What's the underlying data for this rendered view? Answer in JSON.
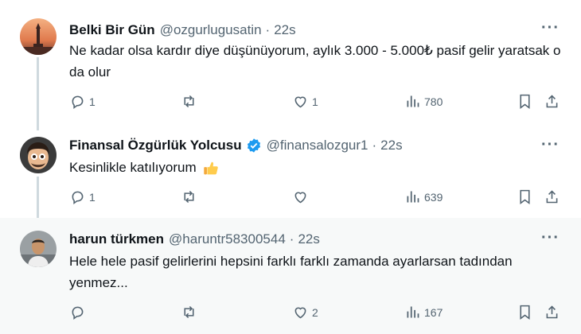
{
  "tweets": [
    {
      "name": "Belki Bir Gün",
      "handle": "@ozgurlugusatin",
      "time": "22s",
      "text": "Ne kadar olsa kardır diye düşünüyorum, aylık 3.000 - 5.000₺ pasif gelir yaratsak o da olur",
      "replies": "1",
      "retweets": "",
      "likes": "1",
      "views": "780"
    },
    {
      "name": "Finansal Özgürlük Yolcusu",
      "handle": "@finansalozgur1",
      "time": "22s",
      "verified": true,
      "text": "Kesinlikle katılıyorum",
      "replies": "1",
      "retweets": "",
      "likes": "",
      "views": "639"
    },
    {
      "name": "harun türkmen",
      "handle": "@haruntr58300544",
      "time": "22s",
      "text": "Hele hele pasif gelirlerini hepsini farklı farklı  zamanda ayarlarsan tadından yenmez...",
      "replies": "",
      "retweets": "",
      "likes": "2",
      "views": "167"
    }
  ],
  "separator": "·",
  "more": "···",
  "icons": {
    "reply": "reply-icon",
    "retweet": "retweet-icon",
    "like": "heart-icon",
    "views": "views-icon",
    "bookmark": "bookmark-icon",
    "share": "share-icon"
  },
  "colors": {
    "verified": "#1d9bf0",
    "muted": "#536471",
    "highlight_bg": "#f7f9f9"
  }
}
